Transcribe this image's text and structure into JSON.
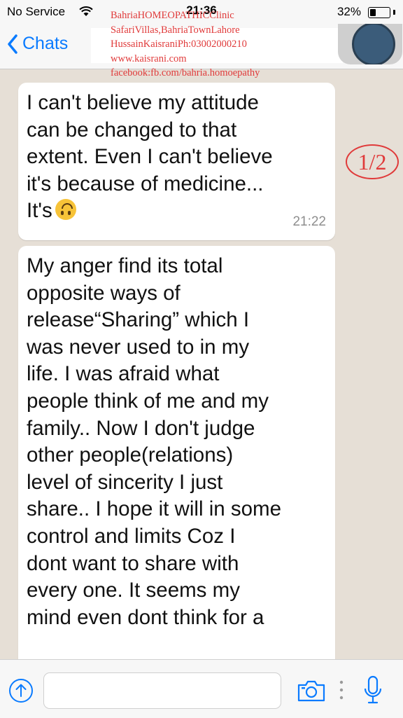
{
  "status": {
    "carrier": "No Service",
    "time": "21:36",
    "battery": "32%",
    "battery_level": 0.32
  },
  "header": {
    "back_label": "Chats"
  },
  "watermark": {
    "lines": [
      "BahriaHOMEOPATHICClinic",
      "SafariVillas,BahriaTownLahore",
      "HussainKaisraniPh:03002000210",
      "www.kaisrani.com",
      "facebook:fb.com/bahria.homoepathy"
    ],
    "page_marker": "1/2"
  },
  "messages": [
    {
      "lines": [
        "I can't believe my attitude",
        "can be changed to that",
        "extent. Even I can't believe",
        "it's because of medicine...",
        "It's"
      ],
      "emoji": "upside-down-face",
      "time": "21:22"
    },
    {
      "lines": [
        "My anger find its total",
        "opposite ways of",
        "release“Sharing” which I",
        "was never used to in my",
        "life. I was afraid what",
        "people think of me and my",
        "family.. Now I don't judge",
        "other people(relations)",
        "level of sincerity I just",
        "share.. I hope it will in some",
        "control and limits Coz I",
        "dont want to share with",
        "every one. It seems my",
        "mind even dont think for a"
      ]
    }
  ],
  "input": {
    "placeholder": ""
  },
  "colors": {
    "accent": "#0a7bff",
    "watermark": "#e03a3a",
    "chat_background": "#e6dfd6",
    "bubble": "#ffffff"
  },
  "icons": [
    "wifi-icon",
    "chevron-left-icon",
    "plus-icon",
    "camera-icon",
    "more-icon",
    "microphone-icon"
  ]
}
